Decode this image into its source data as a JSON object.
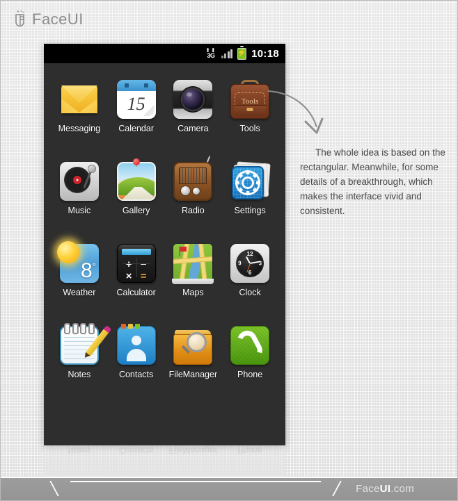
{
  "brand": {
    "wordmark": "FaceUI",
    "logo_icon": "faceui-logo-icon"
  },
  "phone": {
    "statusbar": {
      "network_arrows": "⬆⬇",
      "network_label": "3G",
      "signal_icon": "signal-bars-icon",
      "battery_icon": "battery-charging-icon",
      "battery_bolt": "⚡",
      "clock": "10:18"
    },
    "grid": {
      "rows": [
        [
          {
            "label": "Messaging",
            "icon": "messaging-envelope-icon"
          },
          {
            "label": "Calendar",
            "icon": "calendar-icon",
            "day": "15"
          },
          {
            "label": "Camera",
            "icon": "camera-icon"
          },
          {
            "label": "Tools",
            "icon": "tools-briefcase-icon",
            "badge_text": "Tools"
          }
        ],
        [
          {
            "label": "Music",
            "icon": "music-turntable-icon"
          },
          {
            "label": "Gallery",
            "icon": "gallery-photo-pin-icon"
          },
          {
            "label": "Radio",
            "icon": "radio-icon"
          },
          {
            "label": "Settings",
            "icon": "settings-gear-icon"
          }
        ],
        [
          {
            "label": "Weather",
            "icon": "weather-sun-icon",
            "temp": "8",
            "degree": "°"
          },
          {
            "label": "Calculator",
            "icon": "calculator-icon",
            "keys": [
              "+",
              "−",
              "×",
              "="
            ]
          },
          {
            "label": "Maps",
            "icon": "maps-icon"
          },
          {
            "label": "Clock",
            "icon": "clock-analog-icon",
            "marks": [
              "12",
              "3",
              "6",
              "9"
            ]
          }
        ],
        [
          {
            "label": "Notes",
            "icon": "notes-pencil-icon"
          },
          {
            "label": "Contacts",
            "icon": "contacts-person-icon"
          },
          {
            "label": "FileManager",
            "icon": "filemanager-folder-search-icon"
          },
          {
            "label": "Phone",
            "icon": "phone-handset-icon"
          }
        ]
      ]
    }
  },
  "annotation": {
    "arrow_icon": "curved-arrow-icon",
    "text": "The whole idea is based on the rectangular. Meanwhile, for some details of a breakthrough, which makes the interface vivid and consistent."
  },
  "footer": {
    "site_prefix": "Face",
    "site_bold": "UI",
    "site_suffix": ".com"
  },
  "colors": {
    "screen_bg": "#2e2e2e",
    "statusbar_bg": "#000000",
    "page_bg": "#e4e4e4",
    "footer_bg": "#9a9a9a",
    "battery_green": "#7ec524",
    "note_text": "#4a4a4a"
  }
}
